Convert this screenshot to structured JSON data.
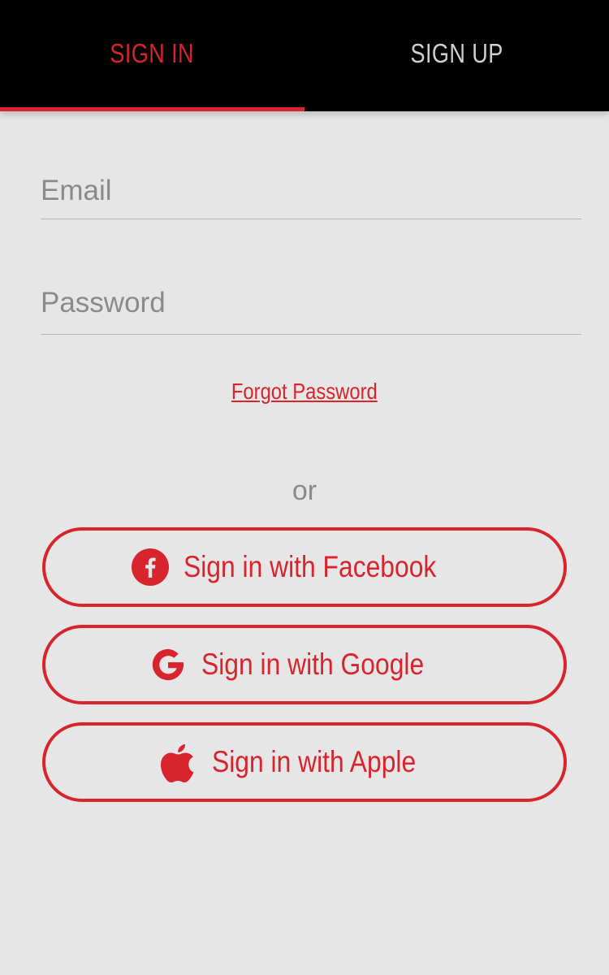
{
  "tabs": [
    {
      "label": "SIGN IN",
      "active": true
    },
    {
      "label": "SIGN UP",
      "active": false
    }
  ],
  "form": {
    "email_placeholder": "Email",
    "password_placeholder": "Password",
    "forgot_label": "Forgot Password"
  },
  "divider_text": "or",
  "social": {
    "facebook_label": "Sign in with Facebook",
    "facebook_icon": "facebook-icon",
    "google_label": "Sign in with Google",
    "google_icon": "google-icon",
    "apple_label": "Sign in with Apple",
    "apple_icon": "apple-icon"
  },
  "colors": {
    "accent": "#d8242c",
    "tabbar_bg": "#000000",
    "page_bg": "#e6e6e6",
    "placeholder": "#8a8a8a"
  }
}
